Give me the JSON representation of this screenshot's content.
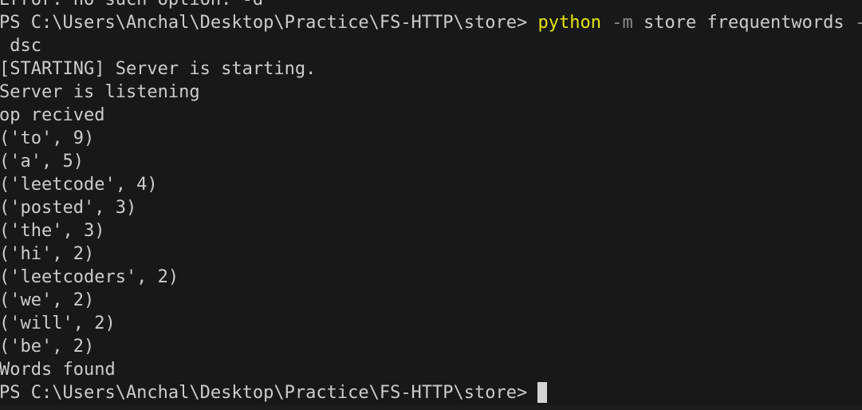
{
  "terminal": {
    "prev_error": "Error: no such option: -d",
    "prompt1": {
      "ps": "PS C:\\Users\\Anchal\\Desktop\\Practice\\FS-HTTP\\store>",
      "exe": "python",
      "flag_m": "-m",
      "args": "store frequentwords",
      "flag_o": "-o",
      "wrap": " dsc"
    },
    "output": [
      "[STARTING] Server is starting.",
      "Server is listening",
      "op recived",
      "('to', 9)",
      "('a', 5)",
      "('leetcode', 4)",
      "('posted', 3)",
      "('the', 3)",
      "('hi', 2)",
      "('leetcoders', 2)",
      "('we', 2)",
      "('will', 2)",
      "('be', 2)",
      "Words found"
    ],
    "prompt2": "PS C:\\Users\\Anchal\\Desktop\\Practice\\FS-HTTP\\store>"
  }
}
